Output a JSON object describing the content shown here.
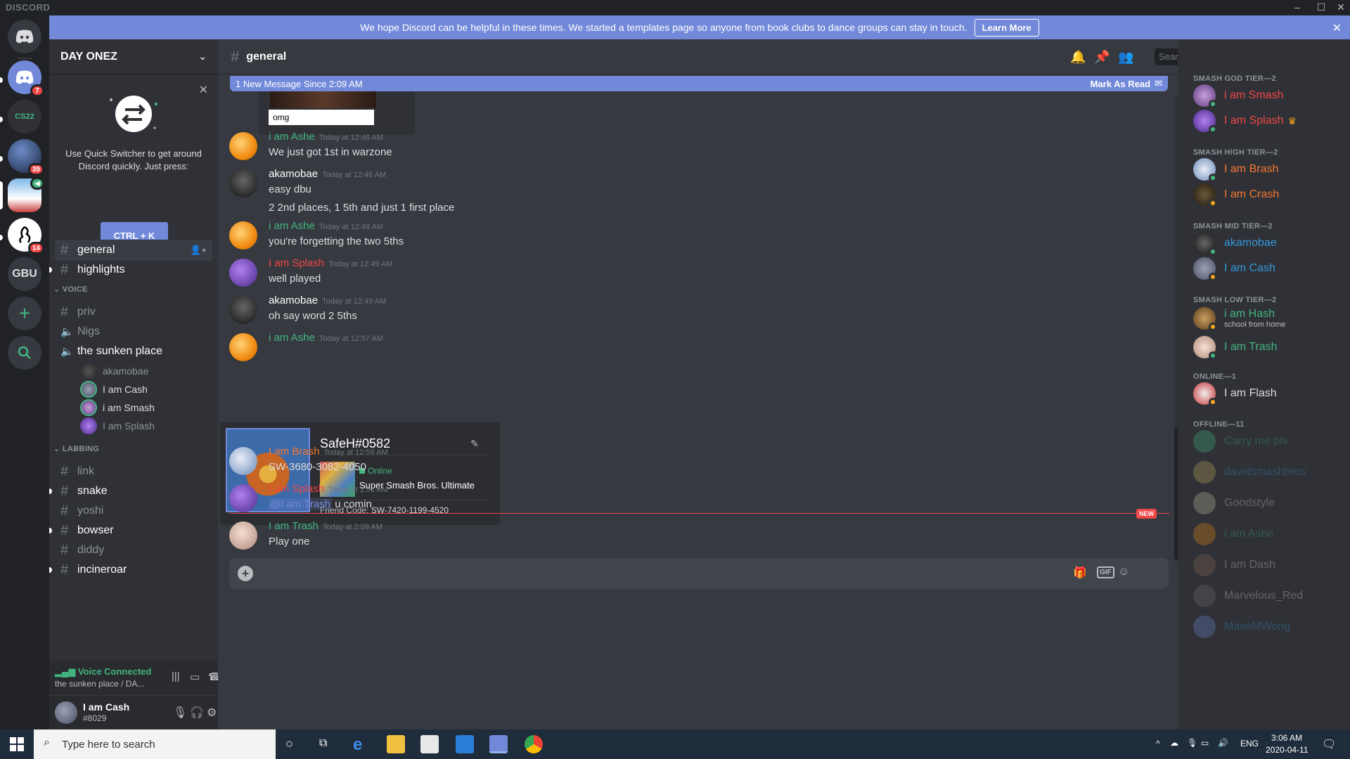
{
  "app": {
    "brand": "DISCORD"
  },
  "notice": {
    "text": "We hope Discord can be helpful in these times. We started a templates page so anyone from book clubs to dance groups can stay in touch.",
    "learn_more": "Learn More"
  },
  "guilds": [
    {
      "badge": "7"
    },
    {
      "label": "CS22"
    },
    {
      "badge": "39"
    },
    {
      "badge": ""
    },
    {
      "badge": "14"
    },
    {
      "label": "GBU"
    }
  ],
  "server": {
    "name": "DAY ONEZ",
    "quick_switcher": {
      "text": "Use Quick Switcher to get around Discord quickly. Just press:",
      "shortcut": "CTRL + K"
    },
    "channels_top": [
      {
        "name": "general"
      },
      {
        "name": "highlights"
      }
    ],
    "voice_category": "VOICE",
    "voice_channels": [
      {
        "name": "priv"
      },
      {
        "name": "Nigs"
      },
      {
        "name": "the sunken place"
      }
    ],
    "voice_users": [
      {
        "name": "akamobae"
      },
      {
        "name": "I am Cash"
      },
      {
        "name": "i am Smash"
      },
      {
        "name": "I am Splash"
      }
    ],
    "labbing_category": "LABBING",
    "labbing_channels": [
      {
        "name": "link"
      },
      {
        "name": "snake"
      },
      {
        "name": "yoshi"
      },
      {
        "name": "bowser"
      },
      {
        "name": "diddy"
      },
      {
        "name": "incineroar"
      }
    ]
  },
  "voice_status": {
    "status": "Voice Connected",
    "location": "the sunken place / DA..."
  },
  "current_user": {
    "name": "I am Cash",
    "tag": "#8029"
  },
  "channel": {
    "name": "general",
    "search_placeholder": "Search"
  },
  "new_banner": {
    "text": "1 New Message Since 2:09 AM",
    "mark_read": "Mark As Read"
  },
  "prev_embed_caption": "omg",
  "messages": [
    {
      "author": "i am Ashe",
      "color": "#43b581",
      "time": "Today at 12:46 AM",
      "lines": [
        "We just got 1st in warzone"
      ]
    },
    {
      "author": "akamobae",
      "color": "#ffffff",
      "time": "Today at 12:46 AM",
      "lines": [
        "easy dbu",
        "2 2nd places, 1 5th and just 1 first place"
      ]
    },
    {
      "author": "i am Ashe",
      "color": "#43b581",
      "time": "Today at 12:48 AM",
      "lines": [
        "you're forgetting the two 5ths"
      ]
    },
    {
      "author": "I am Splash",
      "color": "#f04747",
      "time": "Today at 12:49 AM",
      "lines": [
        "well played"
      ]
    },
    {
      "author": "akamobae",
      "color": "#ffffff",
      "time": "Today at 12:49 AM",
      "lines": [
        "oh say word 2 5ths"
      ]
    },
    {
      "author": "i am Ashe",
      "color": "#43b581",
      "time": "Today at 12:57 AM",
      "lines": []
    },
    {
      "author": "I am Brash",
      "color": "#f57731",
      "time": "Today at 12:58 AM",
      "lines": [
        "SW-3680-3082-4050"
      ]
    },
    {
      "author": "I am Splash",
      "color": "#f04747",
      "time": "Today at 1:51 AM",
      "mention": "@I am Trash",
      "lines": [
        "u comin"
      ]
    },
    {
      "author": "I am Trash",
      "color": "#43b581",
      "time": "Today at 2:09 AM",
      "lines": [
        "Play one"
      ]
    }
  ],
  "profile_card": {
    "name": "SafeH#0582",
    "status": "Online",
    "game": "Super Smash Bros. Ultimate",
    "friend_code_label": "Friend Code:",
    "friend_code": "SW-7420-1199-4520"
  },
  "new_tag": "NEW",
  "members": {
    "groups": [
      {
        "title": "SMASH GOD TIER—2",
        "items": [
          {
            "name": "i am Smash",
            "color": "#f04747"
          },
          {
            "name": "I am Splash",
            "color": "#f04747",
            "crown": "♛"
          }
        ]
      },
      {
        "title": "SMASH HIGH TIER—2",
        "items": [
          {
            "name": "I am Brash",
            "color": "#f57731"
          },
          {
            "name": "I am Crash",
            "color": "#f57731"
          }
        ]
      },
      {
        "title": "SMASH MID TIER—2",
        "items": [
          {
            "name": "akamobae",
            "color": "#3498db"
          },
          {
            "name": "I am Cash",
            "color": "#3498db"
          }
        ]
      },
      {
        "title": "SMASH LOW TIER—2",
        "items": [
          {
            "name": "i am Hash",
            "color": "#43b581",
            "status": "school from home"
          },
          {
            "name": "I am Trash",
            "color": "#43b581"
          }
        ]
      },
      {
        "title": "ONLINE—1",
        "items": [
          {
            "name": "I am Flash",
            "color": "#dcddde"
          }
        ]
      },
      {
        "title": "OFFLINE—11",
        "items": [
          {
            "name": "Carry me pls",
            "color": "#43b581"
          },
          {
            "name": "davidsmashbros",
            "color": "#3498db"
          },
          {
            "name": "Goodstyle",
            "color": "#dcddde"
          },
          {
            "name": "i am Ashe",
            "color": "#43b581"
          },
          {
            "name": "I am Dash",
            "color": "#dcddde"
          },
          {
            "name": "Marvelous_Red",
            "color": "#dcddde"
          },
          {
            "name": "MaseMWong",
            "color": "#3498db"
          }
        ]
      }
    ]
  },
  "taskbar": {
    "search_placeholder": "Type here to search",
    "lang": "ENG",
    "time": "3:06 AM",
    "date": "2020-04-11"
  }
}
